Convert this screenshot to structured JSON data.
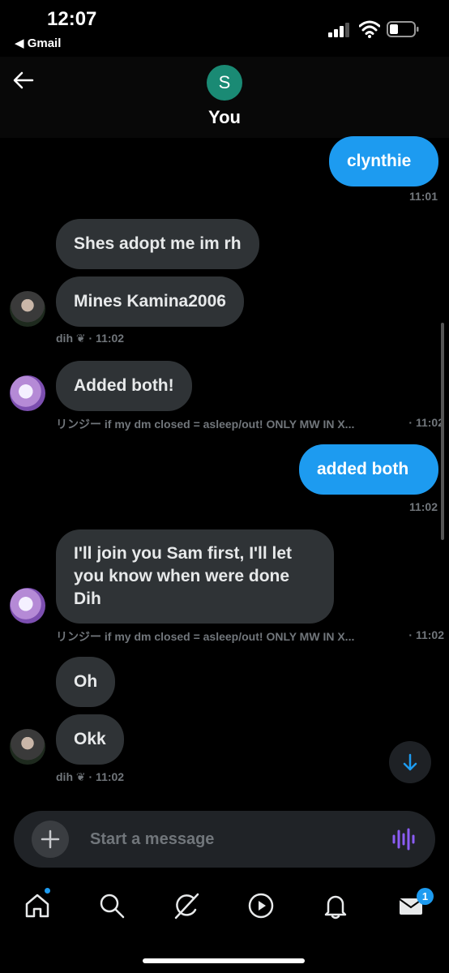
{
  "status": {
    "time": "12:07",
    "back_app": "◀ Gmail"
  },
  "header": {
    "avatar_letter": "S",
    "name": "You"
  },
  "messages": [
    {
      "text": "clynthie",
      "time": "11:01"
    },
    {
      "text": "Shes adopt me im rh"
    },
    {
      "text": "Mines Kamina2006",
      "meta": "dih ❦ · 11:02"
    },
    {
      "text": "Added both!",
      "meta": "リンジー if my dm closed = asleep/out! ONLY MW IN X...",
      "time": "· 11:02"
    },
    {
      "text": "added both",
      "time": "11:02"
    },
    {
      "lines": [
        "I'll join you Sam first, I'll let",
        "you know when were done",
        "Dih"
      ],
      "meta": "リンジー if my dm closed = asleep/out! ONLY MW IN X...",
      "time": "· 11:02"
    },
    {
      "text": "Oh"
    },
    {
      "text": "Okk",
      "meta": "dih ❦ · 11:02"
    }
  ],
  "composer": {
    "placeholder": "Start a message"
  },
  "tabbar": {
    "icons": [
      "home-icon",
      "search-icon",
      "grok-icon",
      "video-icon",
      "notifications-icon",
      "messages-icon"
    ],
    "messages_badge": "1",
    "accent": "#1d9bf0"
  },
  "colors": {
    "outgoing_bubble": "#1d9bf0",
    "incoming_bubble": "#2f3336",
    "voice_accent": "#8b5cf6"
  }
}
